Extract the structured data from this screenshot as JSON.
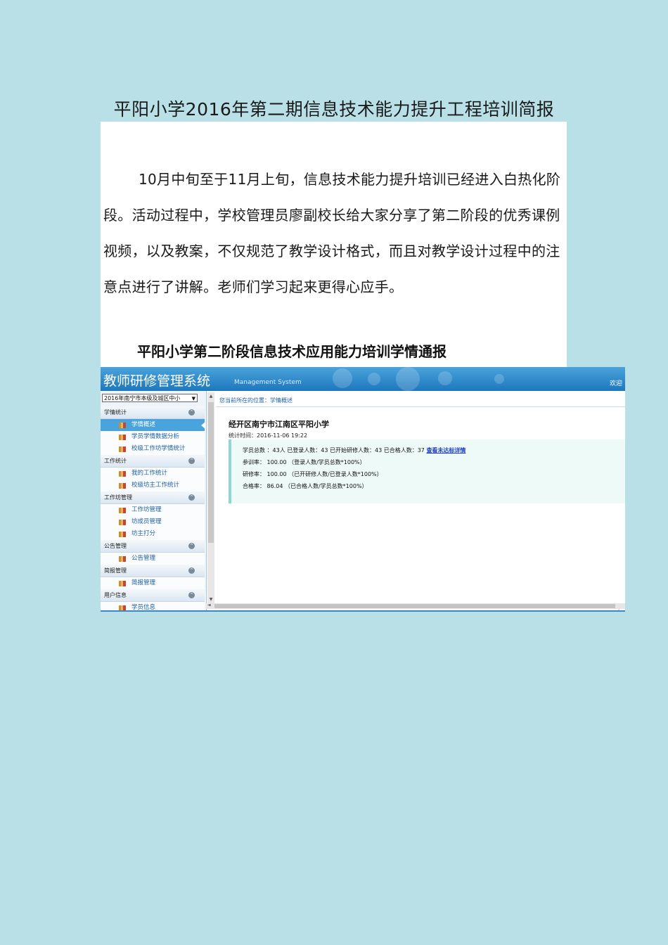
{
  "document": {
    "title": "平阳小学2016年第二期信息技术能力提升工程培训简报",
    "paragraph": "10月中旬至于11月上旬，信息技术能力提升培训已经进入白热化阶段。活动过程中，学校管理员廖副校长给大家分享了第二阶段的优秀课例视频，以及教案，不仅规范了教学设计格式，而且对教学设计过程中的注意点进行了讲解。老师们学习起来更得心应手。",
    "subtitle": "平阳小学第二阶段信息技术应用能力培训学情通报"
  },
  "system": {
    "title": "教师研修管理系统",
    "subtitle": "Management System",
    "header_link": "欢迎"
  },
  "sidebar": {
    "region_select": "2016年南宁市本级及城区中小",
    "groups": [
      {
        "label": "学情统计",
        "items": [
          {
            "label": "学情概述",
            "active": true
          },
          {
            "label": "学员学情数据分析",
            "active": false
          },
          {
            "label": "校级工作坊学情统计",
            "active": false
          }
        ]
      },
      {
        "label": "工作统计",
        "items": [
          {
            "label": "我的工作统计",
            "active": false
          },
          {
            "label": "校级坊主工作统计",
            "active": false
          }
        ]
      },
      {
        "label": "工作坊管理",
        "items": [
          {
            "label": "工作坊管理",
            "active": false
          },
          {
            "label": "坊成员管理",
            "active": false
          },
          {
            "label": "坊主打分",
            "active": false
          }
        ]
      },
      {
        "label": "公告管理",
        "items": [
          {
            "label": "公告管理",
            "active": false
          }
        ]
      },
      {
        "label": "简报管理",
        "items": [
          {
            "label": "简报管理",
            "active": false
          }
        ]
      },
      {
        "label": "用户信息",
        "items": [
          {
            "label": "学员信息",
            "active": false
          }
        ]
      }
    ]
  },
  "main": {
    "breadcrumb": "您当前所在的位置：学情概述",
    "school": "经开区南宁市江南区平阳小学",
    "stat_time": "统计时间：2016-11-06 19:22",
    "stats_line1": "学员总数 ：43人  已登录人数：43  已开始研修人数：43  已合格人数：37 ",
    "stats_link": "查看未达标详情",
    "participation": "参训率：  100.00 （登录人数/学员总数*100%）",
    "study_rate": "研修率：  100.00 （已开研修人数/已登录人数*100%）",
    "pass_rate": "合格率：  86.04 （已合格人数/学员总数*100%）"
  }
}
